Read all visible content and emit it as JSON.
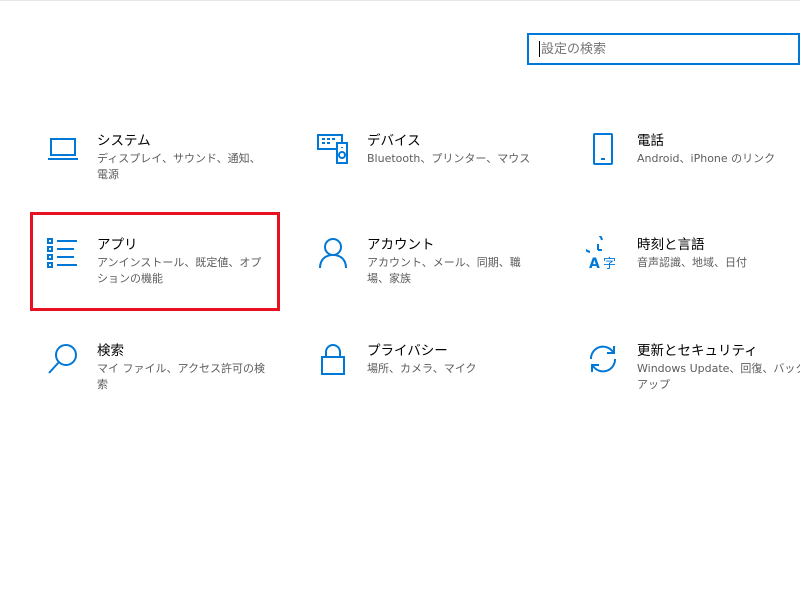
{
  "search": {
    "placeholder": "設定の検索"
  },
  "tiles": [
    {
      "name": "system",
      "title": "システム",
      "desc": "ディスプレイ、サウンド、通知、電源",
      "icon": "laptop-icon"
    },
    {
      "name": "devices",
      "title": "デバイス",
      "desc": "Bluetooth、プリンター、マウス",
      "icon": "devices-icon"
    },
    {
      "name": "phone",
      "title": "電話",
      "desc": "Android、iPhone のリンク",
      "icon": "phone-icon"
    },
    {
      "name": "apps",
      "title": "アプリ",
      "desc": "アンインストール、既定値、オプションの機能",
      "icon": "apps-list-icon"
    },
    {
      "name": "accounts",
      "title": "アカウント",
      "desc": "アカウント、メール、同期、職場、家族",
      "icon": "person-icon"
    },
    {
      "name": "time-language",
      "title": "時刻と言語",
      "desc": "音声認識、地域、日付",
      "icon": "time-language-icon"
    },
    {
      "name": "search",
      "title": "検索",
      "desc": "マイ ファイル、アクセス許可の検索",
      "icon": "search-icon"
    },
    {
      "name": "privacy",
      "title": "プライバシー",
      "desc": "場所、カメラ、マイク",
      "icon": "lock-icon"
    },
    {
      "name": "update-security",
      "title": "更新とセキュリティ",
      "desc": "Windows Update、回復、バックアップ",
      "icon": "sync-icon"
    }
  ],
  "colors": {
    "accent": "#0078d7",
    "highlight": "#e81123",
    "description": "#5d5d5d"
  }
}
